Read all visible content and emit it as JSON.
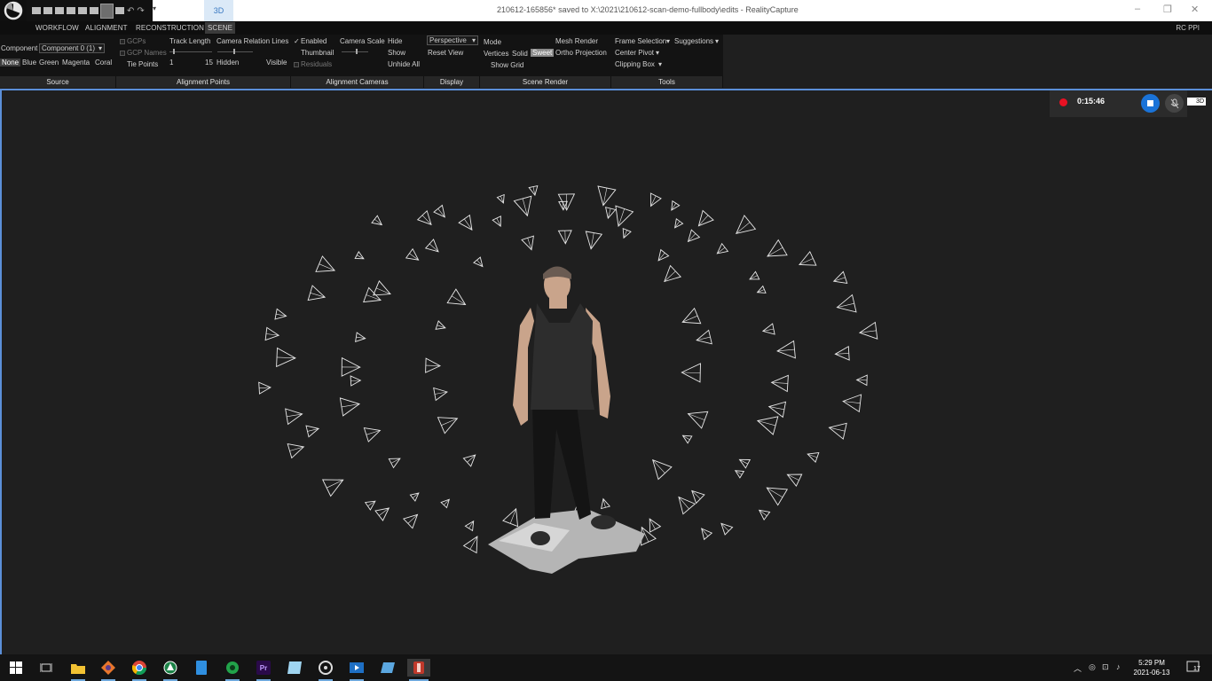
{
  "window": {
    "tab_3d": "3D",
    "title": "210612-165856* saved to X:\\2021\\210612-scan-demo-fullbody\\edits - RealityCapture",
    "controls": [
      "–",
      "❐",
      "✕"
    ]
  },
  "menu": {
    "items": [
      "WORKFLOW",
      "ALIGNMENT",
      "RECONSTRUCTION",
      "SCENE"
    ],
    "active": "SCENE",
    "right_label": "RC PPI"
  },
  "ribbon": {
    "source": {
      "component_label": "Component",
      "component_value": "Component 0 (1)",
      "colors": [
        "None",
        "Blue",
        "Green",
        "Magenta",
        "Coral"
      ],
      "selected_color": "None"
    },
    "alignment_points": {
      "gcps": "GCPs",
      "gcp_names": "GCP Names",
      "tie_points": "Tie Points",
      "track_length": "Track Length",
      "track_min": "1",
      "track_max": "15",
      "relation_lines": "Camera Relation Lines",
      "hidden": "Hidden",
      "visible": "Visible"
    },
    "alignment_cameras": {
      "enabled": "Enabled",
      "thumbnail": "Thumbnail",
      "residuals": "Residuals",
      "camera_scale": "Camera Scale",
      "hide": "Hide",
      "show": "Show",
      "unhide_all": "Unhide All"
    },
    "display": {
      "projection": "Perspective",
      "reset_view": "Reset View"
    },
    "scene_render": {
      "mode": "Mode",
      "vertices": "Vertices",
      "solid": "Solid",
      "sweet": "Sweet",
      "selected_mode": "Sweet",
      "show_grid": "Show Grid",
      "mesh_render": "Mesh Render",
      "ortho_projection": "Ortho Projection"
    },
    "tools": {
      "frame_selection": "Frame Selection",
      "center_pivot": "Center Pivot",
      "clipping_box": "Clipping Box",
      "suggestions": "Suggestions"
    },
    "group_labels": [
      "Source",
      "Alignment Points",
      "Alignment Cameras",
      "Display",
      "Scene Render",
      "Tools"
    ]
  },
  "recorder": {
    "elapsed": "0:15:46",
    "badge": "3D"
  },
  "taskbar": {
    "apps": [
      "start-windows-icon",
      "task-view-icon",
      "file-explorer-icon",
      "app-icon",
      "chrome-icon",
      "app-icon",
      "app-icon",
      "app-icon",
      "premiere-icon",
      "app-icon",
      "app-icon",
      "app-icon",
      "app-icon",
      "realitycapture-icon"
    ],
    "premiere_label": "Pr",
    "time": "5:29 PM",
    "date": "2021-06-13",
    "notifications": "17"
  },
  "colors": {
    "accent": "#5b8fd8",
    "record": "#e81123",
    "stop": "#1a73d8"
  }
}
